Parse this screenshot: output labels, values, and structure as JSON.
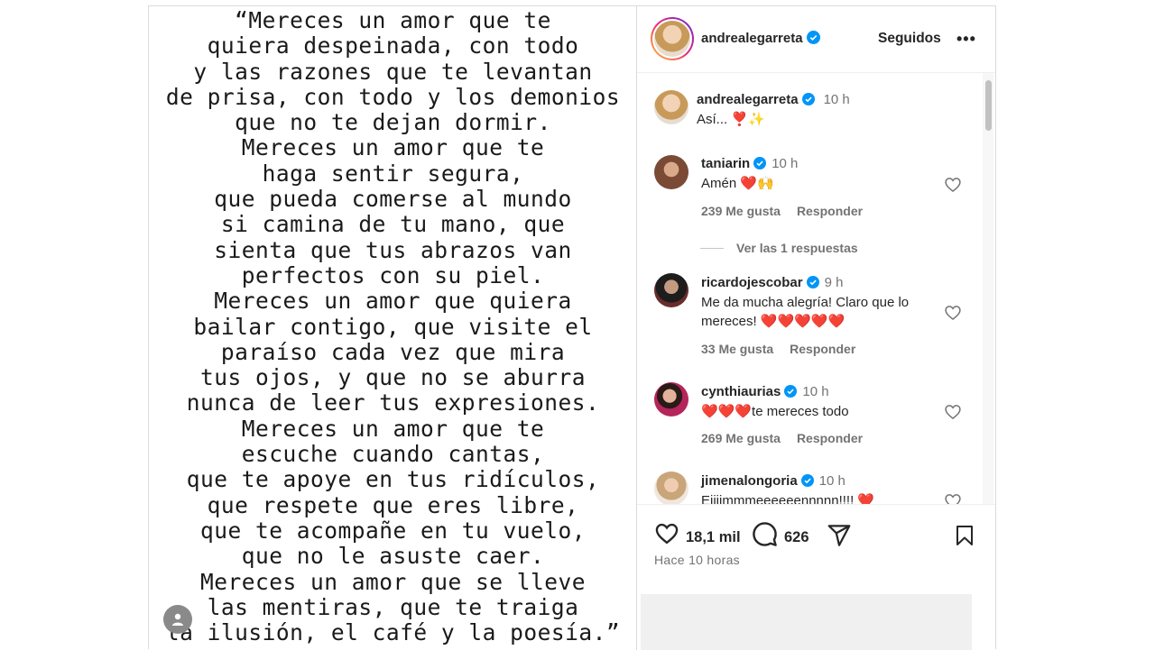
{
  "post": {
    "image_text_lines": [
      "“Mereces un amor que te",
      "quiera despeinada, con todo",
      "y las razones que te levantan",
      "de prisa, con todo y los demonios",
      "que no te dejan dormir.",
      "Mereces un amor que te",
      "haga sentir segura,",
      "que pueda comerse al mundo",
      "si camina de tu mano, que",
      "sienta que tus abrazos van",
      "perfectos con su piel.",
      "Mereces un amor que quiera",
      "bailar contigo, que visite el",
      "paraíso cada vez que mira",
      "tus ojos, y que no se aburra",
      "nunca de leer tus expresiones.",
      "Mereces un amor que te",
      "escuche cuando cantas,",
      "que te apoye en tus ridículos,",
      "que respete que eres libre,",
      "que te acompañe en tu vuelo,",
      "que no le asuste caer.",
      "Mereces un amor que se lleve",
      "las mentiras, que te traiga",
      "la ilusión, el café y la poesía.”"
    ]
  },
  "header": {
    "username": "andrealegarreta",
    "follow_label": "Seguidos",
    "more_label": "•••"
  },
  "caption": {
    "username": "andrealegarreta",
    "time": "10 h",
    "text": "Así... ❣️✨"
  },
  "comments": [
    {
      "username": "taniarin",
      "time": "10 h",
      "text": "Amén ❤️🙌",
      "likes": "239 Me gusta",
      "reply": "Responder",
      "avatar_color": "#7a4a35"
    },
    {
      "username": "ricardojescobar",
      "time": "9 h",
      "text_line1": "Me da mucha alegría! Claro que lo",
      "text_line2": "mereces! ❤️❤️❤️❤️❤️",
      "likes": "33 Me gusta",
      "reply": "Responder",
      "avatar_color": "#3a3a3a"
    },
    {
      "username": "cynthiaurias",
      "time": "10 h",
      "text": "❤️❤️❤️te mereces todo",
      "likes": "269 Me gusta",
      "reply": "Responder",
      "avatar_color": "#b5245a"
    },
    {
      "username": "jimenalongoria",
      "time": "10 h",
      "text": "Eiiiimmmeeeeeennnnn!!!! ❤️",
      "avatar_color": "#c9a57a"
    }
  ],
  "view_replies": "Ver las 1 respuestas",
  "actions": {
    "likes": "18,1 mil",
    "comments": "626",
    "time_ago": "Hace 10 horas"
  },
  "colors": {
    "verified": "#0095f6",
    "heart_red": "#ed4956"
  }
}
